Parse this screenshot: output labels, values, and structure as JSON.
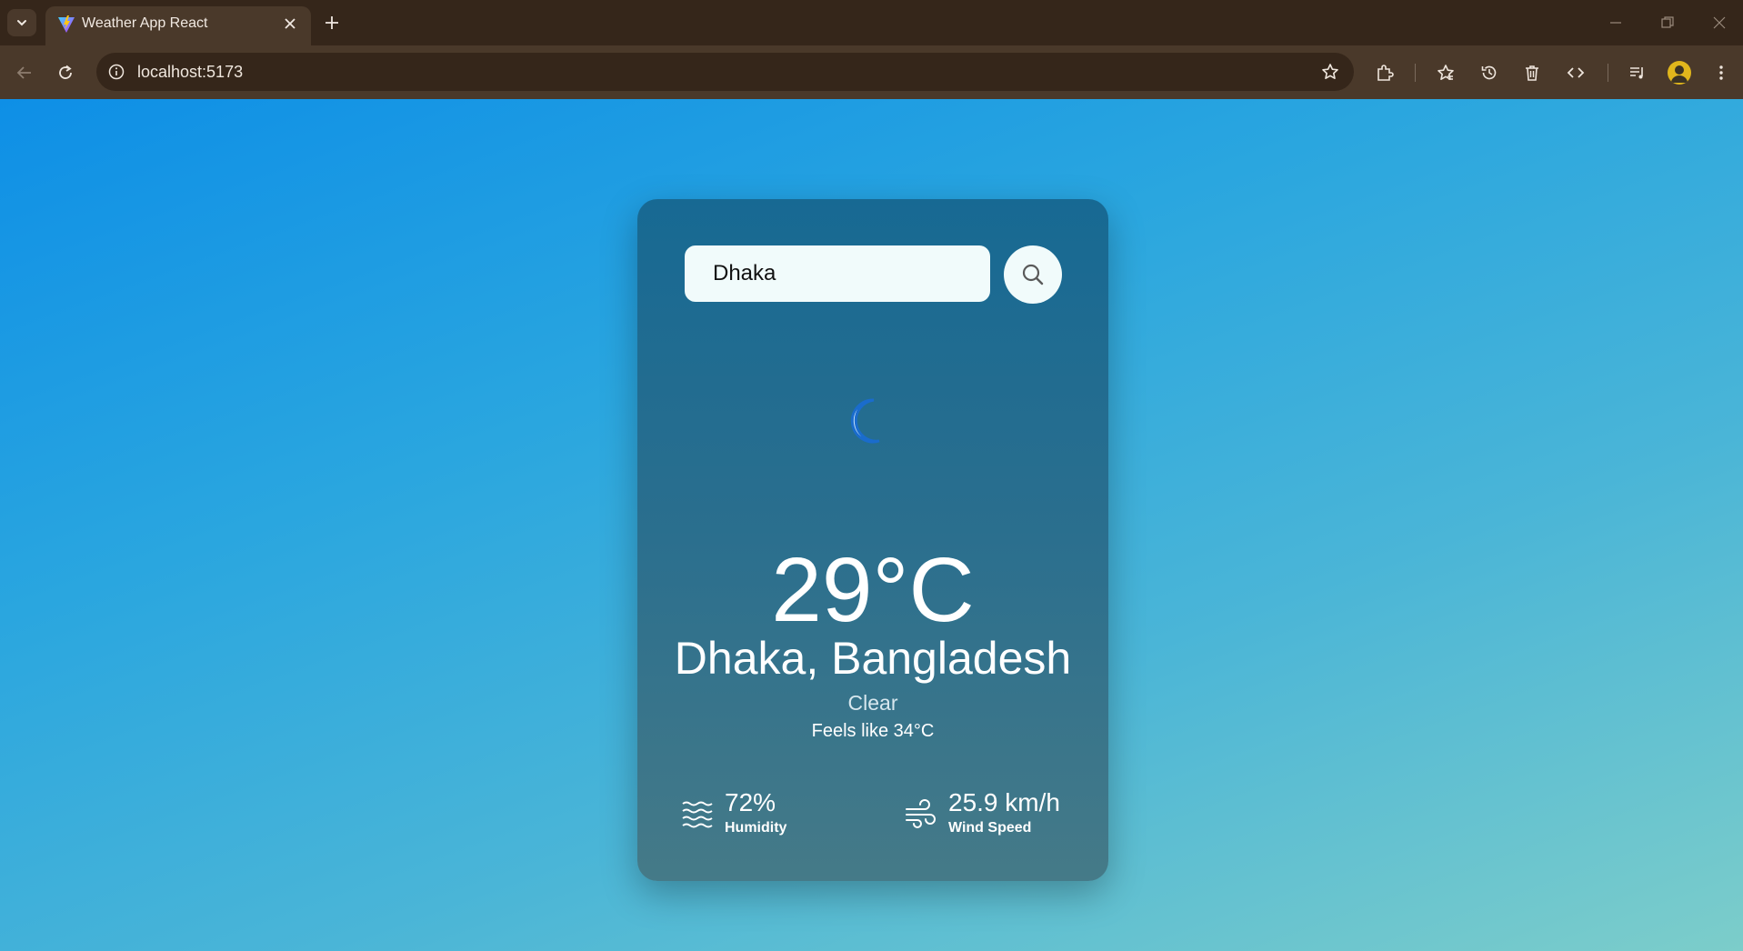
{
  "browser": {
    "tab_title": "Weather App React",
    "url": "localhost:5173"
  },
  "search": {
    "value": "Dhaka"
  },
  "weather": {
    "icon": "moon-icon",
    "temperature": "29°C",
    "location": "Dhaka, Bangladesh",
    "condition": "Clear",
    "feels_like": "Feels like 34°C",
    "humidity": {
      "value": "72%",
      "label": "Humidity",
      "icon": "humidity-icon"
    },
    "wind": {
      "value": "25.9 km/h",
      "label": "Wind Speed",
      "icon": "wind-icon"
    }
  },
  "colors": {
    "page_gradient_start": "#0e8fe6",
    "page_gradient_end": "#7ccdca",
    "card_top": "#176993",
    "card_bottom": "#457a88",
    "browser_frame": "#35261a"
  }
}
